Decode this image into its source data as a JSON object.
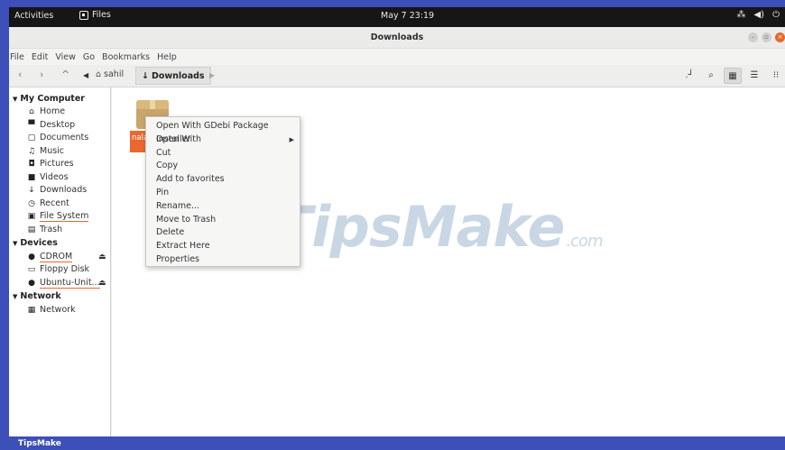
{
  "topbar": {
    "activities": "Activities",
    "app_name": "Files",
    "clock": "May 7  23:19",
    "tray_icons": [
      "network-icon",
      "volume-icon",
      "power-icon"
    ]
  },
  "window": {
    "title": "Downloads"
  },
  "menubar": {
    "items": [
      "File",
      "Edit",
      "View",
      "Go",
      "Bookmarks",
      "Help"
    ]
  },
  "toolbar": {
    "back": "‹",
    "forward": "›",
    "up": "^",
    "crumb_home": "sahil",
    "crumb_current": "Downloads"
  },
  "sidebar": {
    "my_computer": "My Computer",
    "items_computer": [
      {
        "label": "Home",
        "icon": "home-icon",
        "glyph": "⌂"
      },
      {
        "label": "Desktop",
        "icon": "desktop-icon",
        "glyph": "▀"
      },
      {
        "label": "Documents",
        "icon": "document-icon",
        "glyph": "▢"
      },
      {
        "label": "Music",
        "icon": "music-icon",
        "glyph": "♫"
      },
      {
        "label": "Pictures",
        "icon": "camera-icon",
        "glyph": "◘"
      },
      {
        "label": "Videos",
        "icon": "video-icon",
        "glyph": "■"
      },
      {
        "label": "Downloads",
        "icon": "download-icon",
        "glyph": "↓"
      },
      {
        "label": "Recent",
        "icon": "clock-icon",
        "glyph": "◷"
      },
      {
        "label": "File System",
        "icon": "drive-icon",
        "glyph": "▣"
      },
      {
        "label": "Trash",
        "icon": "trash-icon",
        "glyph": "▤"
      }
    ],
    "devices": "Devices",
    "items_devices": [
      {
        "label": "CDROM",
        "icon": "disc-icon",
        "glyph": "●"
      },
      {
        "label": "Floppy Disk",
        "icon": "floppy-icon",
        "glyph": "▭"
      },
      {
        "label": "Ubuntu-Unit...",
        "icon": "disc-icon",
        "glyph": "●"
      }
    ],
    "network": "Network",
    "items_network": [
      {
        "label": "Network",
        "icon": "network-icon",
        "glyph": "▦"
      }
    ]
  },
  "file": {
    "name": "nala_0"
  },
  "context_menu": {
    "items": [
      "Open With GDebi Package Installer",
      "Open With",
      "Cut",
      "Copy",
      "Add to favorites",
      "Pin",
      "Rename...",
      "Move to Trash",
      "Delete",
      "Extract Here",
      "Properties"
    ]
  },
  "watermark": {
    "text": "TipsMake",
    "suffix": ".com"
  },
  "bottom": {
    "brand": "TipsMake"
  }
}
